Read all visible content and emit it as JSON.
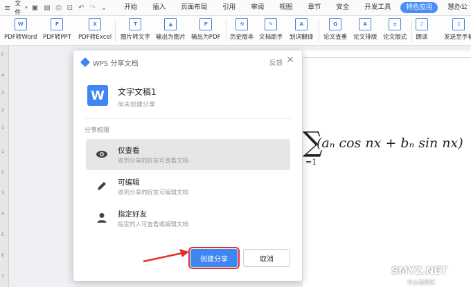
{
  "menubar": {
    "file_label": "文件",
    "tabs": [
      "开始",
      "插入",
      "页面布局",
      "引用",
      "审阅",
      "视图",
      "章节",
      "安全",
      "开发工具",
      "特色应用",
      "慧办公"
    ],
    "active_tab": "特色应用"
  },
  "ribbon": {
    "buttons": [
      {
        "label": "PDF转Word",
        "icon": "W"
      },
      {
        "label": "PDF转PPT",
        "icon": "P"
      },
      {
        "label": "PDF转Excel",
        "icon": "X"
      },
      {
        "label": "图片转文字",
        "icon": "T"
      },
      {
        "label": "输出为图片",
        "icon": "▲"
      },
      {
        "label": "输出为PDF",
        "icon": "P"
      },
      {
        "label": "历史版本",
        "icon": "⟲"
      },
      {
        "label": "文档助手",
        "icon": "✎"
      },
      {
        "label": "划词翻译",
        "icon": "A"
      },
      {
        "label": "论文查重",
        "icon": "Q"
      },
      {
        "label": "论文排版",
        "icon": "A"
      },
      {
        "label": "论文版式",
        "icon": "≡"
      },
      {
        "label": "朗读",
        "icon": "♪"
      },
      {
        "label": "发送至手机",
        "icon": "▯"
      }
    ]
  },
  "document": {
    "formula_sigma": "∑",
    "formula_text": "(aₙ cos nx + bₙ sin nx)",
    "formula_lower": "=1"
  },
  "dialog": {
    "title": "WPS 分享文档",
    "feedback": "反馈",
    "doc_name": "文字文稿1",
    "doc_status": "尚未创建分享",
    "permission_label": "分享权限",
    "options": [
      {
        "title": "仅查看",
        "subtitle": "收到分享的好友可查看文档",
        "icon": "eye-icon",
        "selected": true
      },
      {
        "title": "可编辑",
        "subtitle": "收到分享的好友可编辑文档",
        "icon": "pencil-icon",
        "selected": false
      },
      {
        "title": "指定好友",
        "subtitle": "指定的人可查看或编辑文档",
        "icon": "person-icon",
        "selected": false
      }
    ],
    "create_button": "创建分享",
    "cancel_button": "取消"
  },
  "watermark": {
    "text": "SMYZ.NET",
    "sub": "什么值得买"
  },
  "colors": {
    "accent": "#3f86f3",
    "highlight": "#e03030"
  }
}
